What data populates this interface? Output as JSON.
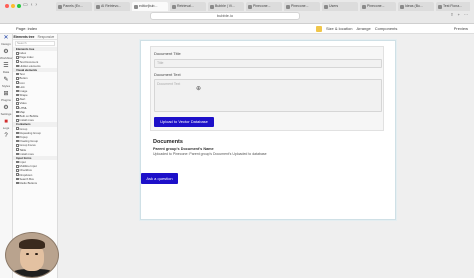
{
  "browser": {
    "tabs": [
      {
        "label": "Panels (Ex...",
        "active": false
      },
      {
        "label": "AI Retrievo...",
        "active": false
      },
      {
        "label": "editor|bub...",
        "active": true
      },
      {
        "label": "Retrieval...",
        "active": false
      },
      {
        "label": "Bubble | Vi...",
        "active": false
      },
      {
        "label": "Pinecone...",
        "active": false
      },
      {
        "label": "Pinecone...",
        "active": false
      },
      {
        "label": "Users",
        "active": false
      },
      {
        "label": "Pinecone...",
        "active": false
      },
      {
        "label": "Ideas (Bu...",
        "active": false
      },
      {
        "label": "Test Fiona...",
        "active": false
      }
    ],
    "url": "bubble.io",
    "right_items": [
      "⇪",
      "+",
      "⋯"
    ]
  },
  "editor": {
    "page_select": "Page: index",
    "tools": [
      "Size & location",
      "Arrange",
      "Components"
    ],
    "right_label": "Preview"
  },
  "rail": [
    {
      "label": "Design",
      "icon": "design-icon",
      "glyph": "✕",
      "state": "active"
    },
    {
      "label": "Workflow",
      "icon": "workflow-icon",
      "glyph": "⚙",
      "state": ""
    },
    {
      "label": "Data",
      "icon": "data-icon",
      "glyph": "☰",
      "state": ""
    },
    {
      "label": "Styles",
      "icon": "styles-icon",
      "glyph": "✎",
      "state": ""
    },
    {
      "label": "Plugins",
      "icon": "plugins-icon",
      "glyph": "⊞",
      "state": ""
    },
    {
      "label": "Settings",
      "icon": "settings-icon",
      "glyph": "⚙",
      "state": ""
    },
    {
      "label": "Logs",
      "icon": "logs-icon",
      "glyph": "■",
      "state": "red"
    },
    {
      "label": "",
      "icon": "help-icon",
      "glyph": "?",
      "state": ""
    }
  ],
  "panel": {
    "tabs": [
      "Elements tree",
      "Responsive"
    ],
    "search_placeholder": "Search",
    "lines": [
      {
        "text": "Elements tree",
        "section": true
      },
      {
        "text": "index",
        "section": false
      },
      {
        "text": "Page index",
        "section": false
      },
      {
        "text": "Text Document",
        "section": false
      },
      {
        "text": "Hidden elements",
        "section": false
      },
      {
        "text": "Visual elements",
        "section": true
      },
      {
        "text": "Text",
        "section": false
      },
      {
        "text": "Button",
        "section": false
      },
      {
        "text": "Icon",
        "section": false
      },
      {
        "text": "Link",
        "section": false
      },
      {
        "text": "Image",
        "section": false
      },
      {
        "text": "Shape",
        "section": false
      },
      {
        "text": "Alert",
        "section": false
      },
      {
        "text": "Video",
        "section": false
      },
      {
        "text": "HTML",
        "section": false
      },
      {
        "text": "Map",
        "section": false
      },
      {
        "text": "Built on Bubble",
        "section": false
      },
      {
        "text": "Install more",
        "section": false
      },
      {
        "text": "Containers",
        "section": true
      },
      {
        "text": "Group",
        "section": false
      },
      {
        "text": "Repeating Group",
        "section": false
      },
      {
        "text": "Popup",
        "section": false
      },
      {
        "text": "Floating Group",
        "section": false
      },
      {
        "text": "Group Focus",
        "section": false
      },
      {
        "text": "Table",
        "section": false
      },
      {
        "text": "Install more",
        "section": false
      },
      {
        "text": "Input forms",
        "section": true
      },
      {
        "text": "Input",
        "section": false
      },
      {
        "text": "Multiline Input",
        "section": false
      },
      {
        "text": "Checkbox",
        "section": false
      },
      {
        "text": "Dropdown",
        "section": false
      },
      {
        "text": "Search Box",
        "section": false
      },
      {
        "text": "Radio Buttons",
        "section": false
      }
    ]
  },
  "form": {
    "title_label": "Document Title",
    "title_placeholder": "Title",
    "text_label": "Document Text",
    "text_placeholder": "Document Text",
    "upload_button": "Upload to Vector Database"
  },
  "documents": {
    "heading": "Documents",
    "item_title": "Parent group's Document's Name",
    "item_text": "Uploaded to Pinecone: Parent group's Document's Uploaded to database"
  },
  "ask_button": "Ask a question",
  "colors": {
    "primary_button": "#1d10c9",
    "frame_border": "#cfe0e6"
  }
}
